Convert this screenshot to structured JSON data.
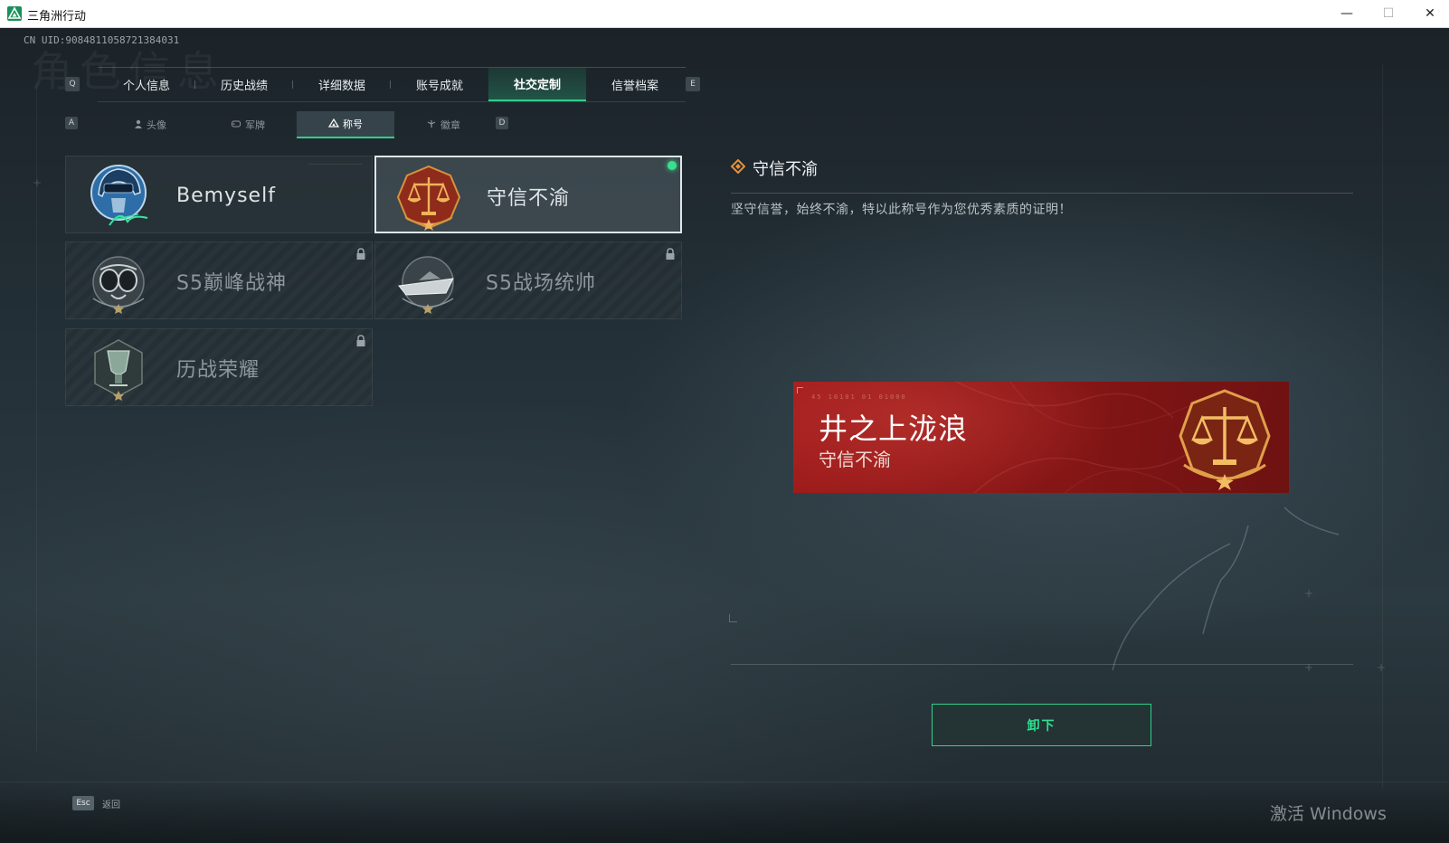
{
  "window": {
    "title": "三角洲行动",
    "controls": {
      "minimize": "—",
      "maximize": "☐",
      "close": "✕"
    }
  },
  "header": {
    "uid": "CN UID:9084811058721384031",
    "watermark": "角色信息"
  },
  "main_tabs": {
    "left_key": "Q",
    "right_key": "E",
    "items": [
      {
        "label": "个人信息"
      },
      {
        "label": "历史战绩"
      },
      {
        "label": "详细数据"
      },
      {
        "label": "账号成就"
      },
      {
        "label": "社交定制",
        "active": true
      },
      {
        "label": "信誉档案"
      }
    ]
  },
  "sub_tabs": {
    "left_key": "A",
    "right_key": "D",
    "items": [
      {
        "label": "头像",
        "icon": "person-icon"
      },
      {
        "label": "军牌",
        "icon": "dogtag-icon"
      },
      {
        "label": "称号",
        "icon": "title-icon",
        "active": true
      },
      {
        "label": "徽章",
        "icon": "badge-icon"
      }
    ]
  },
  "titles": [
    {
      "label": "Bemyself",
      "icon": "helmet-signature-icon",
      "locked": false,
      "selected": false
    },
    {
      "label": "守信不渝",
      "icon": "scales-icon",
      "locked": false,
      "selected": true,
      "equipped": true
    },
    {
      "label": "S5巅峰战神",
      "icon": "diving-mask-icon",
      "locked": true
    },
    {
      "label": "S5战场统帅",
      "icon": "speedboat-icon",
      "locked": true
    },
    {
      "label": "历战荣耀",
      "icon": "trophy-icon",
      "locked": true
    }
  ],
  "detail": {
    "title": "守信不渝",
    "description": "坚守信誉，始终不渝，特以此称号作为您优秀素质的证明！",
    "preview": {
      "player_name": "井之上泷浪",
      "title": "守信不渝",
      "small_text": "45 10101 01 01000"
    },
    "action_button": "卸下"
  },
  "footer": {
    "esc_key": "Esc",
    "esc_label": "返回",
    "os_watermark": "激活 Windows"
  },
  "colors": {
    "accent": "#2fd08a",
    "nameplate_red": "#8a1717",
    "emblem_gold": "#d9963a"
  }
}
